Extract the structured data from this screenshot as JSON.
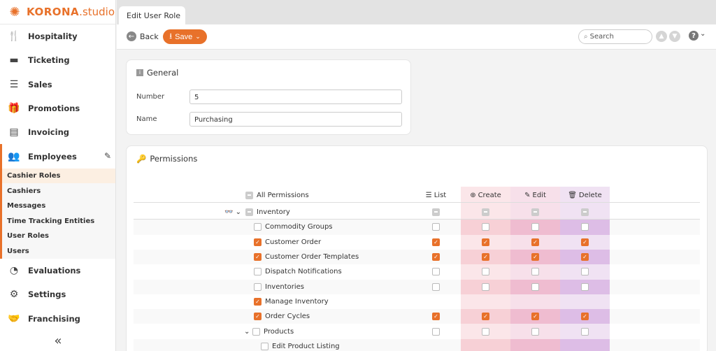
{
  "app": {
    "brand": "KORONA",
    "brand_suffix": ".studio"
  },
  "sidebar": {
    "items": [
      {
        "label": "Hospitality",
        "icon": "fork-knife-icon"
      },
      {
        "label": "Ticketing",
        "icon": "ticket-icon"
      },
      {
        "label": "Sales",
        "icon": "receipt-icon"
      },
      {
        "label": "Promotions",
        "icon": "gift-icon"
      },
      {
        "label": "Invoicing",
        "icon": "cabinet-icon"
      },
      {
        "label": "Employees",
        "icon": "users-icon"
      }
    ],
    "subitems": [
      "Cashier Roles",
      "Cashiers",
      "Messages",
      "Time Tracking Entities",
      "User Roles",
      "Users"
    ],
    "bottom_items": [
      {
        "label": "Evaluations",
        "icon": "pie-chart-icon"
      },
      {
        "label": "Settings",
        "icon": "gear-icon"
      },
      {
        "label": "Franchising",
        "icon": "handshake-icon"
      }
    ],
    "collapse": "«"
  },
  "tab": {
    "label": "Edit User Role"
  },
  "toolbar": {
    "back": "Back",
    "save": "Save",
    "search_placeholder": "Search"
  },
  "general": {
    "title": "General",
    "number_label": "Number",
    "number_value": "5",
    "name_label": "Name",
    "name_value": "Purchasing"
  },
  "permissions": {
    "title": "Permissions",
    "all_label": "All Permissions",
    "columns": [
      "List",
      "Create",
      "Edit",
      "Delete"
    ],
    "colors": {
      "create": "#f7d0d6",
      "edit": "#efbcd0",
      "delete": "#ddbde6"
    },
    "rows": [
      {
        "label": "Inventory",
        "state": "mix",
        "cols": [
          "mix",
          "mix",
          "mix",
          "mix"
        ]
      },
      {
        "label": "Commodity Groups",
        "state": "off",
        "cols": [
          "off",
          "off",
          "off",
          "off"
        ]
      },
      {
        "label": "Customer Order",
        "state": "on",
        "cols": [
          "on",
          "on",
          "on",
          "on"
        ]
      },
      {
        "label": "Customer Order Templates",
        "state": "on",
        "cols": [
          "on",
          "on",
          "on",
          "on"
        ]
      },
      {
        "label": "Dispatch Notifications",
        "state": "off",
        "cols": [
          "off",
          "off",
          "off",
          "off"
        ]
      },
      {
        "label": "Inventories",
        "state": "off",
        "cols": [
          "off",
          "off",
          "off",
          "off"
        ]
      },
      {
        "label": "Manage Inventory",
        "state": "on",
        "cols": [
          "",
          "",
          "",
          ""
        ]
      },
      {
        "label": "Order Cycles",
        "state": "on",
        "cols": [
          "on",
          "on",
          "on",
          "on"
        ]
      },
      {
        "label": "Products",
        "state": "off",
        "cols": [
          "off",
          "off",
          "off",
          "off"
        ]
      },
      {
        "label": "Edit Product Listing",
        "state": "off",
        "cols": [
          "",
          "",
          "",
          ""
        ]
      }
    ]
  }
}
